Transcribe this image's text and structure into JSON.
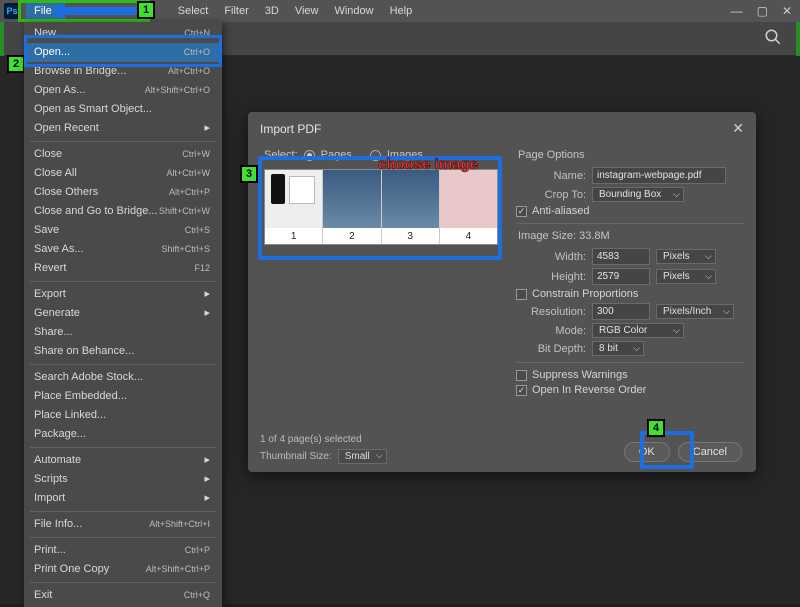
{
  "menubar": {
    "items": [
      "File",
      "Select",
      "Filter",
      "3D",
      "View",
      "Window",
      "Help"
    ],
    "ps_badge": "Ps"
  },
  "file_menu": {
    "groups": [
      [
        {
          "label": "New...",
          "shortcut": "Ctrl+N"
        },
        {
          "label": "Open...",
          "shortcut": "Ctrl+O",
          "highlight": true
        },
        {
          "label": "Browse in Bridge...",
          "shortcut": "Alt+Ctrl+O"
        },
        {
          "label": "Open As...",
          "shortcut": "Alt+Shift+Ctrl+O"
        },
        {
          "label": "Open as Smart Object...",
          "shortcut": ""
        },
        {
          "label": "Open Recent",
          "shortcut": "",
          "submenu": true
        }
      ],
      [
        {
          "label": "Close",
          "shortcut": "Ctrl+W"
        },
        {
          "label": "Close All",
          "shortcut": "Alt+Ctrl+W"
        },
        {
          "label": "Close Others",
          "shortcut": "Alt+Ctrl+P"
        },
        {
          "label": "Close and Go to Bridge...",
          "shortcut": "Shift+Ctrl+W"
        },
        {
          "label": "Save",
          "shortcut": "Ctrl+S"
        },
        {
          "label": "Save As...",
          "shortcut": "Shift+Ctrl+S"
        },
        {
          "label": "Revert",
          "shortcut": "F12"
        }
      ],
      [
        {
          "label": "Export",
          "shortcut": "",
          "submenu": true
        },
        {
          "label": "Generate",
          "shortcut": "",
          "submenu": true
        },
        {
          "label": "Share...",
          "shortcut": ""
        },
        {
          "label": "Share on Behance...",
          "shortcut": ""
        }
      ],
      [
        {
          "label": "Search Adobe Stock...",
          "shortcut": ""
        },
        {
          "label": "Place Embedded...",
          "shortcut": ""
        },
        {
          "label": "Place Linked...",
          "shortcut": ""
        },
        {
          "label": "Package...",
          "shortcut": ""
        }
      ],
      [
        {
          "label": "Automate",
          "shortcut": "",
          "submenu": true
        },
        {
          "label": "Scripts",
          "shortcut": "",
          "submenu": true
        },
        {
          "label": "Import",
          "shortcut": "",
          "submenu": true
        }
      ],
      [
        {
          "label": "File Info...",
          "shortcut": "Alt+Shift+Ctrl+I"
        }
      ],
      [
        {
          "label": "Print...",
          "shortcut": "Ctrl+P"
        },
        {
          "label": "Print One Copy",
          "shortcut": "Alt+Shift+Ctrl+P"
        }
      ],
      [
        {
          "label": "Exit",
          "shortcut": "Ctrl+Q"
        }
      ]
    ]
  },
  "dialog": {
    "title": "Import PDF",
    "select_label": "Select:",
    "radio_pages": "Pages",
    "radio_images": "Images",
    "thumb_labels": [
      "1",
      "2",
      "3",
      "4"
    ],
    "selected_info": "1 of 4 page(s) selected",
    "thumb_size_label": "Thumbnail Size:",
    "thumb_size_value": "Small",
    "page_options_title": "Page Options",
    "name_label": "Name:",
    "name_value": "instagram-webpage.pdf",
    "cropto_label": "Crop To:",
    "cropto_value": "Bounding Box",
    "anti_aliased": "Anti-aliased",
    "image_size_title": "Image Size: 33.8M",
    "width_label": "Width:",
    "width_value": "4583",
    "width_unit": "Pixels",
    "height_label": "Height:",
    "height_value": "2579",
    "height_unit": "Pixels",
    "constrain": "Constrain Proportions",
    "resolution_label": "Resolution:",
    "resolution_value": "300",
    "resolution_unit": "Pixels/Inch",
    "mode_label": "Mode:",
    "mode_value": "RGB Color",
    "bitdepth_label": "Bit Depth:",
    "bitdepth_value": "8 bit",
    "suppress": "Suppress Warnings",
    "reverse": "Open In Reverse Order",
    "ok": "OK",
    "cancel": "Cancel"
  },
  "annotations": {
    "choose_image": "choose image",
    "step1": "1",
    "step2": "2",
    "step3": "3",
    "step4": "4"
  }
}
